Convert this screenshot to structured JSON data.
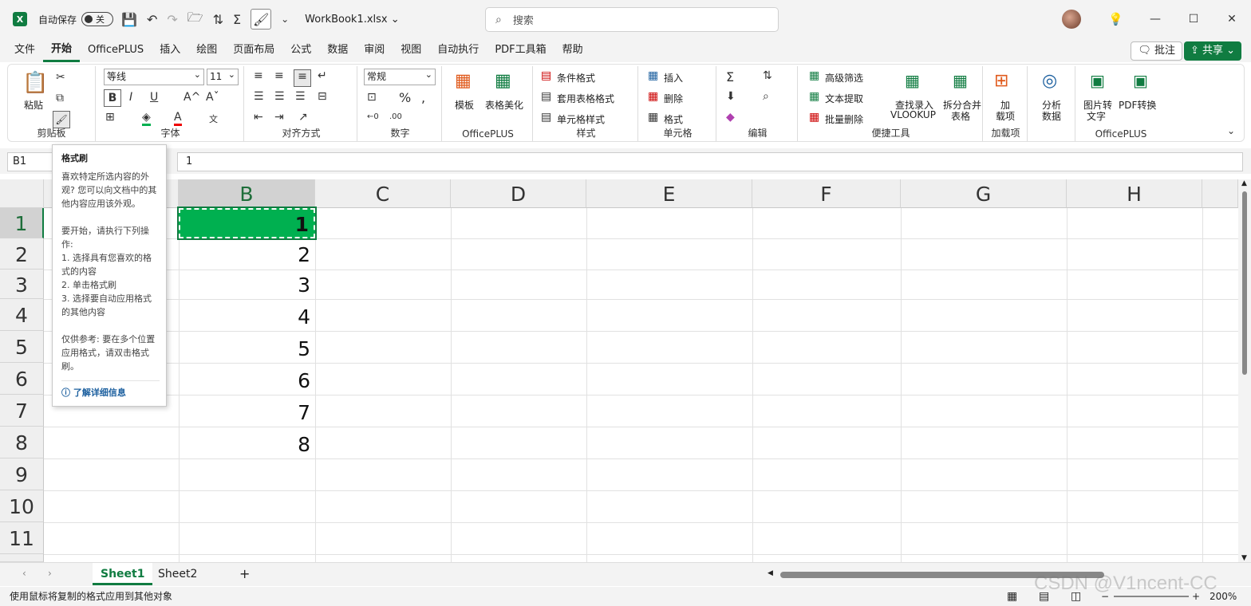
{
  "titlebar": {
    "app_logo": "X",
    "autosave_label": "自动保存",
    "autosave_state": "关",
    "doc_name": "WorkBook1.xlsx ⌄",
    "search_placeholder": "搜索",
    "min": "—",
    "max": "☐",
    "close": "✕"
  },
  "tabs": [
    "文件",
    "开始",
    "OfficePLUS",
    "插入",
    "绘图",
    "页面布局",
    "公式",
    "数据",
    "审阅",
    "视图",
    "自动执行",
    "PDF工具箱",
    "帮助"
  ],
  "active_tab": "开始",
  "comment_label": "批注",
  "share_label": "共享 ⌄",
  "ribbon": {
    "clipboard": {
      "paste": "粘贴",
      "label": "剪贴板"
    },
    "font": {
      "name": "等线",
      "size": "11",
      "label": "字体"
    },
    "alignment": {
      "label": "对齐方式"
    },
    "number": {
      "format": "常规",
      "label": "数字"
    },
    "officeplus": {
      "template": "模板",
      "beautify": "表格美化",
      "label": "OfficePLUS"
    },
    "styles": {
      "cond": "条件格式",
      "table": "套用表格格式",
      "cell": "单元格样式",
      "label": "样式"
    },
    "cells": {
      "insert": "插入",
      "delete": "删除",
      "format": "格式",
      "label": "单元格"
    },
    "editing": {
      "label": "编辑"
    },
    "tools": {
      "adv_filter": "高级筛选",
      "text_extract": "文本提取",
      "batch_delete": "批量删除",
      "lookup": "查找录入",
      "lookup2": "VLOOKUP",
      "split": "拆分合并",
      "split2": "表格",
      "label": "便捷工具"
    },
    "addins": {
      "add": "加",
      "add2": "载项",
      "label": "加载项"
    },
    "analyze": {
      "a1": "分析",
      "a2": "数据"
    },
    "officeplus2": {
      "img": "图片转",
      "img2": "文字",
      "pdf": "PDF转换",
      "label": "OfficePLUS"
    }
  },
  "namebox": "B1",
  "formula": "1",
  "columns": [
    "B",
    "C",
    "D",
    "E",
    "F",
    "G",
    "H"
  ],
  "rows": [
    "1",
    "2",
    "3",
    "4",
    "5",
    "6",
    "7",
    "8",
    "9",
    "10",
    "11"
  ],
  "cells_b": [
    "1",
    "2",
    "3",
    "4",
    "5",
    "6",
    "7",
    "8"
  ],
  "tooltip": {
    "title": "格式刷",
    "p1": "喜欢特定所选内容的外观? 您可以向文档中的其他内容应用该外观。",
    "p2": "要开始，请执行下列操作:\n1. 选择具有您喜欢的格式的内容\n2. 单击格式刷\n3. 选择要自动应用格式的其他内容",
    "p3": "仅供参考: 要在多个位置应用格式，请双击格式刷。",
    "link": "了解详细信息"
  },
  "sheets": [
    "Sheet1",
    "Sheet2"
  ],
  "add_sheet": "+",
  "status_text": "使用鼠标将复制的格式应用到其他对象",
  "zoom": "200%",
  "watermark": "CSDN @V1ncent-CC",
  "colors": {
    "accent": "#107c41",
    "selection_fill": "#00b050"
  }
}
